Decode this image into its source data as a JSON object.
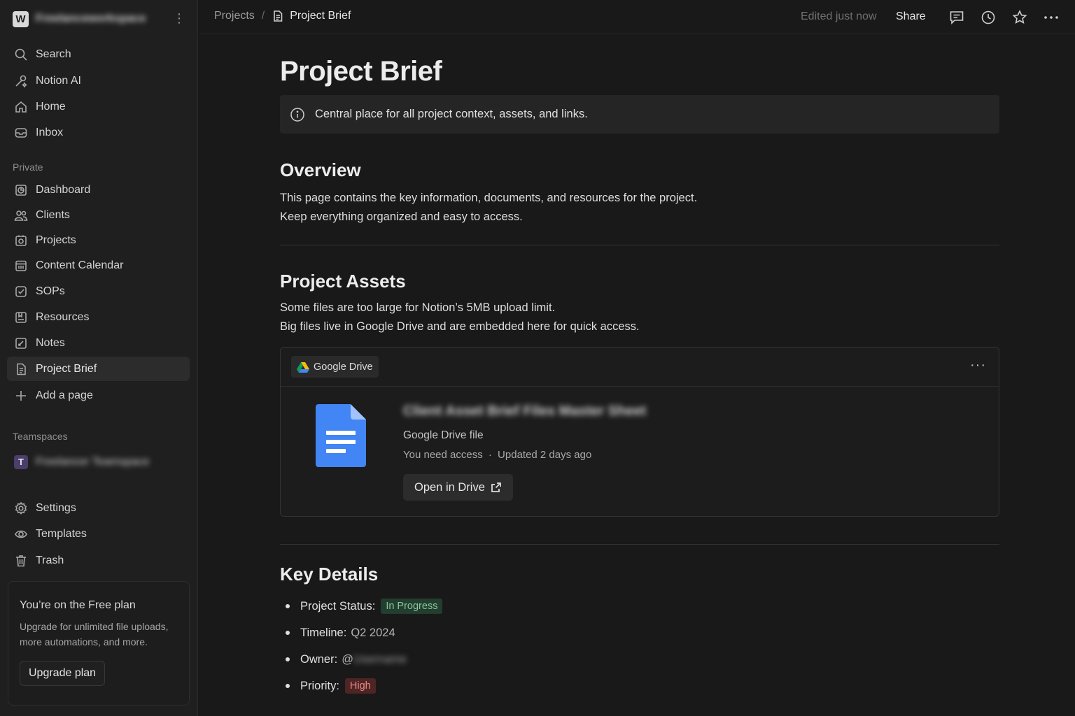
{
  "workspace": {
    "initial": "W",
    "name": "Freelanceworkspace"
  },
  "sidebar": {
    "top_items": [
      {
        "label": "Search",
        "icon": "search-icon"
      },
      {
        "label": "Notion AI",
        "icon": "notion-ai-icon"
      },
      {
        "label": "Home",
        "icon": "home-icon"
      },
      {
        "label": "Inbox",
        "icon": "inbox-icon"
      }
    ],
    "private_label": "Private",
    "private_items": [
      {
        "label": "Dashboard",
        "icon": "dashboard-icon"
      },
      {
        "label": "Clients",
        "icon": "people-icon"
      },
      {
        "label": "Projects",
        "icon": "projects-icon"
      },
      {
        "label": "Content Calendar",
        "icon": "calendar-icon"
      },
      {
        "label": "SOPs",
        "icon": "sops-icon"
      },
      {
        "label": "Resources",
        "icon": "resources-icon"
      },
      {
        "label": "Notes",
        "icon": "notes-icon"
      },
      {
        "label": "Project Brief",
        "icon": "document-icon",
        "active": true
      }
    ],
    "add_page_label": "Add a page",
    "teamspaces_label": "Teamspaces",
    "teamspace": {
      "initial": "T",
      "name": "Freelancer Teamspace"
    },
    "bottom_items": [
      {
        "label": "Settings",
        "icon": "gear-icon"
      },
      {
        "label": "Templates",
        "icon": "templates-icon"
      },
      {
        "label": "Trash",
        "icon": "trash-icon"
      }
    ],
    "plan": {
      "title": "You’re on the Free plan",
      "description_line1": "Upgrade for unlimited file uploads,",
      "description_line2": "more automations, and more.",
      "button": "Upgrade plan"
    }
  },
  "topbar": {
    "breadcrumb_parent": "Projects",
    "breadcrumb_separator": "/",
    "breadcrumb_current": "Project Brief",
    "edited": "Edited just now",
    "share": "Share"
  },
  "page": {
    "title": "Project Brief",
    "callout": "Central place for all project context, assets, and links.",
    "overview": {
      "heading": "Overview",
      "line1": "This page contains the key information, documents, and resources for the project.",
      "line2": "Keep everything organized and easy to access."
    },
    "assets": {
      "heading": "Project Assets",
      "line1": "Some files are too large for Notion’s 5MB upload limit.",
      "line2": "Big files live in Google Drive and are embedded here for quick access.",
      "embed": {
        "source": "Google Drive",
        "file_title": "Client Asset Brief Files Master Sheet",
        "file_type": "Google Drive file",
        "access": "You need access",
        "meta_separator": "·",
        "updated": "Updated 2 days ago",
        "open_button": "Open in Drive"
      }
    },
    "key_details": {
      "heading": "Key Details",
      "status_label": "Project Status:",
      "status_value": "In Progress",
      "timeline_label": "Timeline:",
      "timeline_value": "Q2 2024",
      "owner_label": "Owner:",
      "owner_at": "@",
      "owner_value": "Username",
      "priority_label": "Priority:",
      "priority_value": "High"
    }
  },
  "colors": {
    "background": "#191919",
    "sidebar": "#1f1f1f",
    "status_tag_bg": "#233d2e",
    "status_tag_text": "#86c89c",
    "priority_tag_bg": "#4e2425",
    "priority_tag_text": "#e98b84",
    "doc_blue": "#4285f4"
  }
}
